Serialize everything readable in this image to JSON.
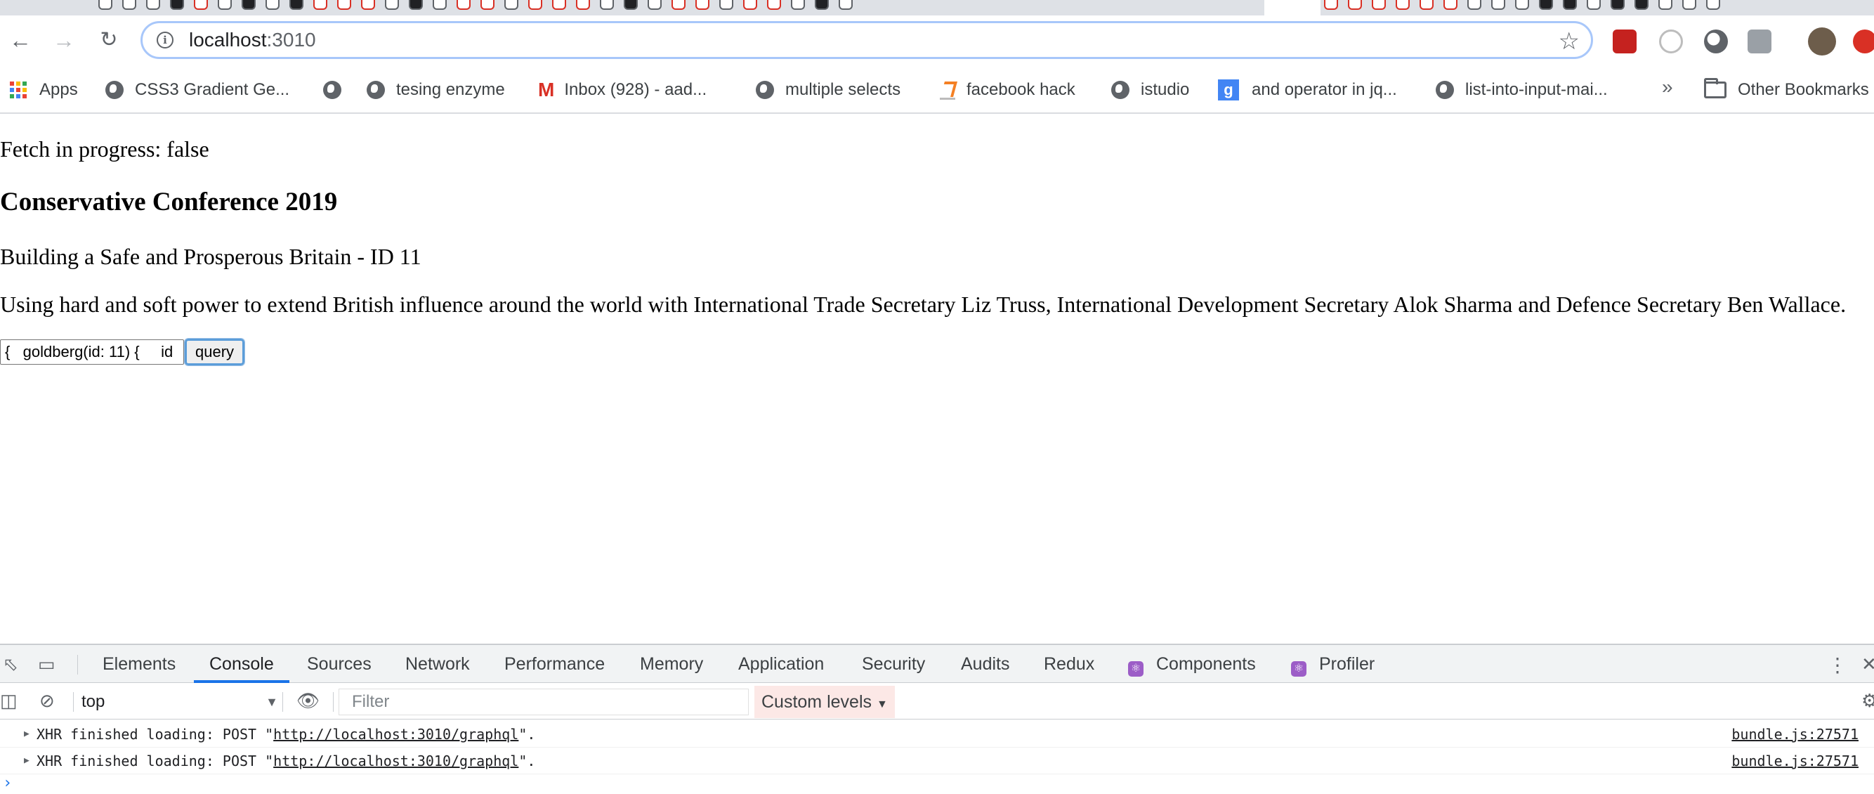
{
  "browser": {
    "url_host": "localhost",
    "url_port": ":3010",
    "bookmarks": [
      {
        "label": "Apps",
        "icon": "apps-grid-icon"
      },
      {
        "label": "CSS3 Gradient Ge...",
        "icon": "globe-icon"
      },
      {
        "label": "",
        "icon": "globe-icon"
      },
      {
        "label": "tesing enzyme",
        "icon": "globe-icon"
      },
      {
        "label": "Inbox (928) - aad...",
        "icon": "gmail-icon"
      },
      {
        "label": "multiple selects",
        "icon": "globe-icon"
      },
      {
        "label": "facebook hack",
        "icon": "stackoverflow-icon"
      },
      {
        "label": "istudio",
        "icon": "globe-icon"
      },
      {
        "label": "and operator in jq...",
        "icon": "google-icon"
      },
      {
        "label": "list-into-input-mai...",
        "icon": "globe-icon"
      }
    ],
    "overflow_label": "»",
    "other_bookmarks": "Other Bookmarks"
  },
  "page": {
    "fetch_status": "Fetch in progress: false",
    "title": "Conservative Conference 2019",
    "subtitle": "Building a Safe and Prosperous Britain - ID 11",
    "description": "Using hard and soft power to extend British influence around the world with International Trade Secretary Liz Truss, International Development Secretary Alok Sharma and Defence Secretary Ben Wallace.",
    "query_input_value": "{   goldberg(id: 11) {     id",
    "query_button": "query"
  },
  "devtools": {
    "tabs": [
      "Elements",
      "Console",
      "Sources",
      "Network",
      "Performance",
      "Memory",
      "Application",
      "Security",
      "Audits",
      "Redux",
      "Components",
      "Profiler"
    ],
    "active_tab": "Console",
    "context": "top",
    "filter_placeholder": "Filter",
    "levels": "Custom levels",
    "logs": [
      {
        "prefix": "XHR finished loading: POST \"",
        "link": "http://localhost:3010/graphql",
        "suffix": "\".",
        "source": "bundle.js:27571"
      },
      {
        "prefix": "XHR finished loading: POST \"",
        "link": "http://localhost:3010/graphql",
        "suffix": "\".",
        "source": "bundle.js:27571"
      }
    ],
    "prompt": "›"
  },
  "colors": {
    "accent": "#1a73e8",
    "omnibox_focus": "#a8c7fa",
    "levels_bg": "#fce8e6",
    "react_icon": "#9c5dc7"
  }
}
